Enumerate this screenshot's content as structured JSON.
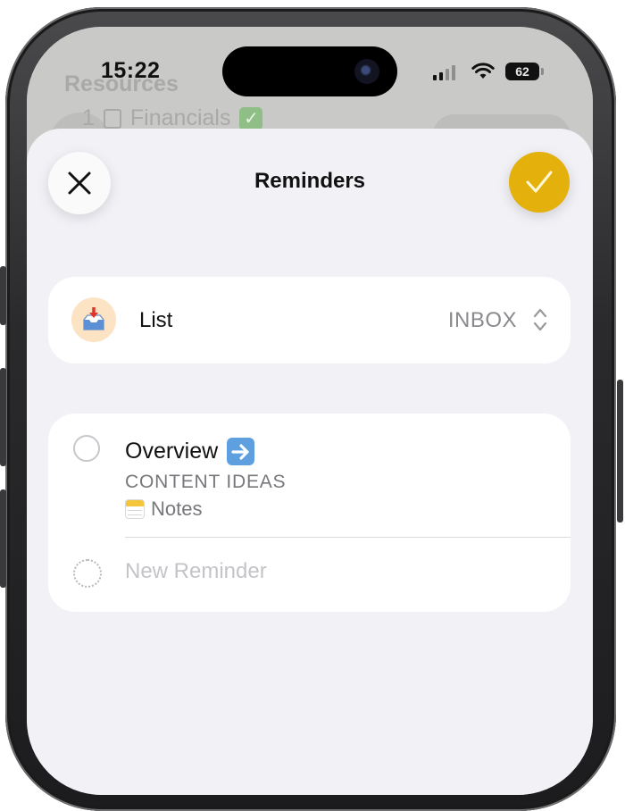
{
  "status_bar": {
    "time": "15:22",
    "battery": "62",
    "signal_icon": "cellular-signal-icon",
    "wifi_icon": "wifi-icon"
  },
  "background_app": {
    "section_title": "Resources",
    "row_number": "1",
    "row_label": "Financials",
    "row_icon": "document-icon",
    "row_badge_icon": "green-check-icon"
  },
  "sheet": {
    "title": "Reminders",
    "close_icon": "close-icon",
    "done_icon": "checkmark-icon",
    "accent_color": "#E4B10C"
  },
  "list_row": {
    "icon": "inbox-tray-icon",
    "label": "List",
    "value": "INBOX",
    "chevron_icon": "up-down-chevron-icon"
  },
  "reminders": [
    {
      "title": "Overview",
      "title_icon": "right-arrow-icon",
      "subtitle": "CONTENT IDEAS",
      "source_icon": "notes-app-icon",
      "source": "Notes"
    }
  ],
  "new_reminder": {
    "placeholder": "New Reminder"
  }
}
